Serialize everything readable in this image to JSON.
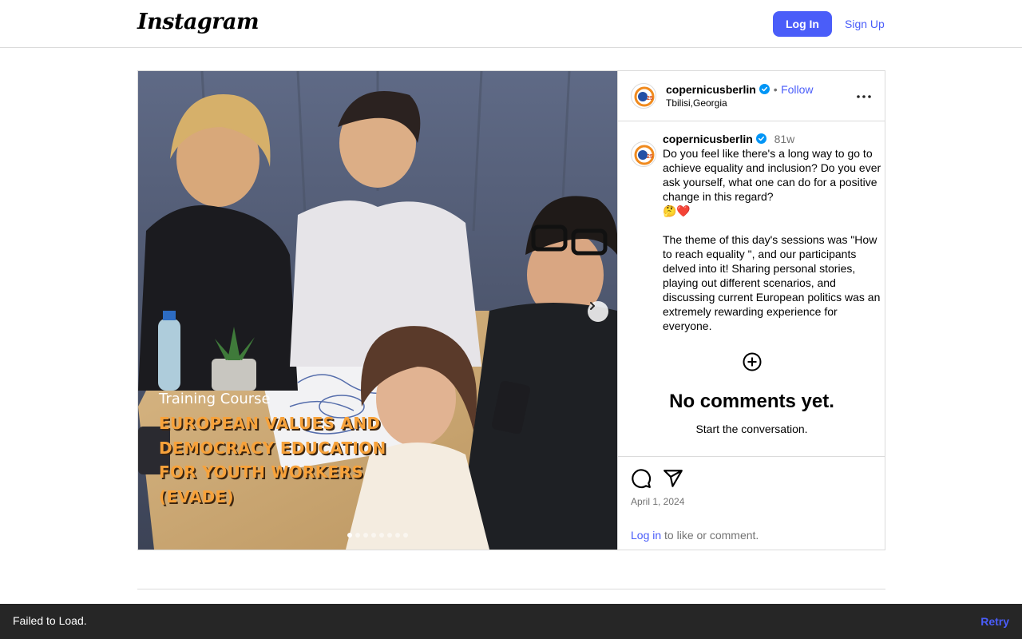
{
  "nav": {
    "logo": "Instagram",
    "login_label": "Log In",
    "signup_label": "Sign Up"
  },
  "media": {
    "overlay_label": "Training Course",
    "overlay_title_lines": [
      "EUROPEAN VALUES AND",
      "DEMOCRACY EDUCATION",
      "FOR YOUTH WORKERS",
      "(EVADE)"
    ],
    "slide_count": 8,
    "active_slide": 1
  },
  "post": {
    "username": "copernicusberlin",
    "follow_label": "Follow",
    "separator": "•",
    "location": "Tbilisi,Georgia",
    "caption": {
      "username": "copernicusberlin",
      "time_ago": "81w",
      "paragraph1": "Do you feel like there's a long way to go to achieve equality and inclusion? Do you ever ask yourself, what one can do for a positive change in this regard?",
      "emoji": "🤔❤️",
      "paragraph2": "The theme of this day's sessions was \"How to reach equality \", and our participants delved into it! Sharing personal stories, playing out different scenarios, and discussing current European politics was an extremely rewarding experience for everyone."
    },
    "comments_empty_title": "No comments yet.",
    "comments_empty_subtitle": "Start the conversation.",
    "date": "April 1, 2024",
    "login_link": "Log in",
    "login_suffix": " to like or comment."
  },
  "toast": {
    "message": "Failed to Load.",
    "retry_label": "Retry"
  },
  "colors": {
    "accent": "#4a5df9",
    "border": "#dbdbdb",
    "muted": "#737373",
    "toast_bg": "#262626",
    "overlay_title": "#f7a23b",
    "verified": "#0095f6"
  }
}
